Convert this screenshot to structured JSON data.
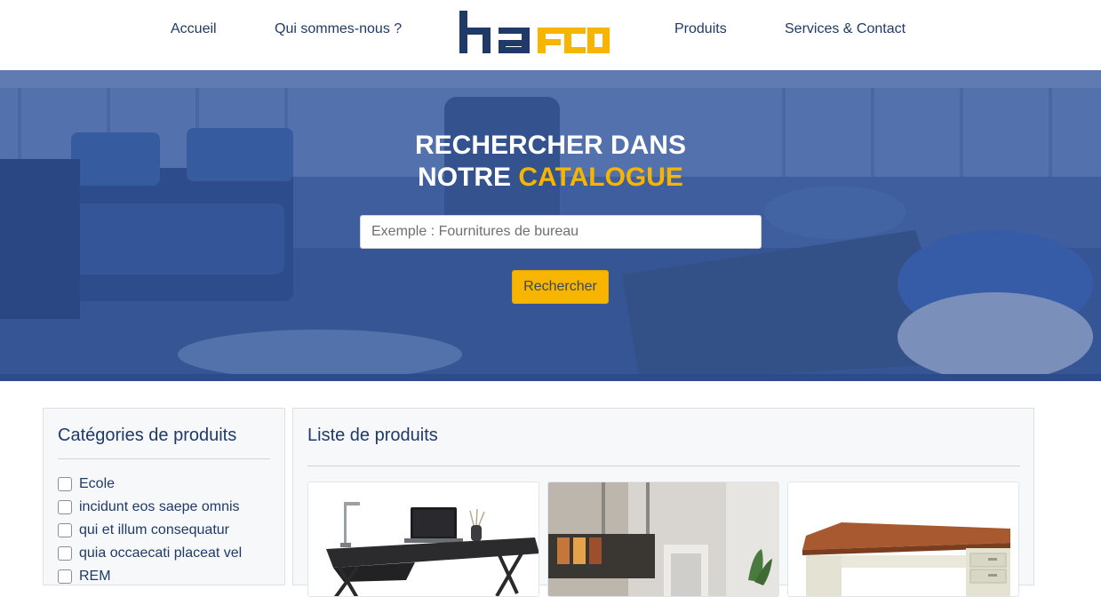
{
  "nav": {
    "items": [
      "Accueil",
      "Qui sommes-nous ?",
      "Produits",
      "Services & Contact"
    ],
    "logo_text": "hafco"
  },
  "hero": {
    "title_line1": "RECHERCHER DANS",
    "title_line2_prefix": "NOTRE ",
    "title_line2_accent": "CATALOGUE",
    "search_placeholder": "Exemple : Fournitures de bureau",
    "search_button": "Rechercher"
  },
  "sidebar": {
    "title": "Catégories de produits",
    "categories": [
      "Ecole",
      "incidunt eos saepe omnis",
      "qui et illum consequatur",
      "quia occaecati placeat vel",
      "REM"
    ]
  },
  "products": {
    "title": "Liste de produits",
    "items": [
      {
        "image": "desk-with-laptop"
      },
      {
        "image": "office-interior"
      },
      {
        "image": "executive-desk"
      }
    ]
  },
  "colors": {
    "brand_navy": "#1f3a68",
    "accent_yellow": "#f7b500"
  }
}
